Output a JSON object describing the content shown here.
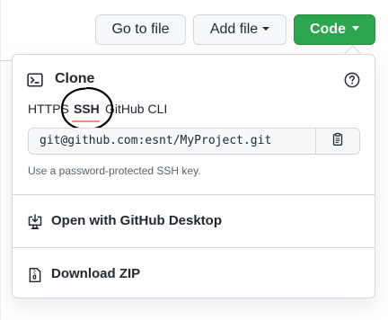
{
  "toolbar": {
    "go_to_file_label": "Go to file",
    "add_file_label": "Add file",
    "code_label": "Code"
  },
  "clone": {
    "title": "Clone",
    "tabs": [
      {
        "label": "HTTPS",
        "selected": false
      },
      {
        "label": "SSH",
        "selected": true
      },
      {
        "label": "GitHub CLI",
        "selected": false
      }
    ],
    "url": "git@github.com:esnt/MyProject.git",
    "hint": "Use a password-protected SSH key."
  },
  "menu": {
    "open_desktop_label": "Open with GitHub Desktop",
    "download_zip_label": "Download ZIP"
  },
  "colors": {
    "code_button": "#2da44e",
    "tab_underline": "#fd8c73",
    "annotation": "#000000"
  },
  "icons": [
    "terminal-icon",
    "question-icon",
    "copy-icon",
    "desktop-download-icon",
    "file-zip-icon",
    "caret-down-icon"
  ]
}
